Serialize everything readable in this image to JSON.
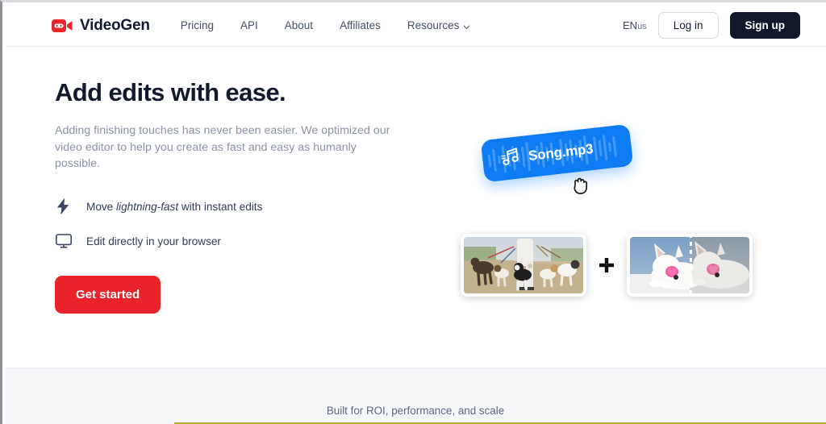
{
  "brand": {
    "name": "VideoGen",
    "icon": "video-camera-icon",
    "color": "#e8232a"
  },
  "nav": {
    "links": [
      {
        "label": "Pricing",
        "has_menu": false
      },
      {
        "label": "API",
        "has_menu": false
      },
      {
        "label": "About",
        "has_menu": false
      },
      {
        "label": "Affiliates",
        "has_menu": false
      },
      {
        "label": "Resources",
        "has_menu": true
      }
    ],
    "language": {
      "code": "EN",
      "region": "us"
    },
    "login_label": "Log in",
    "signup_label": "Sign up"
  },
  "hero": {
    "headline": "Add edits with ease.",
    "subcopy": "Adding finishing touches has never been easier. We optimized our video editor to help you create as fast and easy as humanly possible.",
    "features": [
      {
        "icon": "lightning-bolt-icon",
        "prefix": "Move ",
        "emphasis": "lightning-fast",
        "suffix": " with instant edits"
      },
      {
        "icon": "monitor-icon",
        "prefix": "Edit directly in your browser",
        "emphasis": "",
        "suffix": ""
      }
    ],
    "cta_label": "Get started",
    "cta_color": "#e8232a"
  },
  "art": {
    "audio_chip": {
      "label": "Song.mp3",
      "icon": "music-note-icon",
      "color": "#0d7cf2",
      "cursor": "grabbing-hand-cursor"
    },
    "combine_symbol": "+",
    "photos": [
      {
        "name": "dog-walker-photo",
        "alt": "Person walking several dogs on leashes"
      },
      {
        "name": "puppy-sunglasses-photo",
        "alt": "White puppy wearing pink heart sunglasses"
      }
    ],
    "cut_tool": "scissors-icon"
  },
  "footer": {
    "tagline": "Built for ROI, performance, and scale"
  }
}
